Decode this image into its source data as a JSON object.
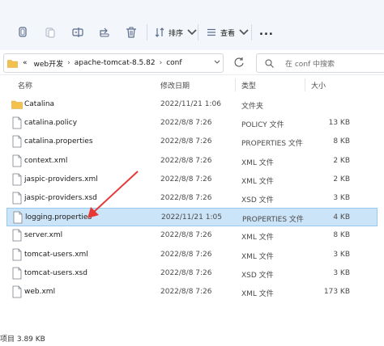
{
  "toolbar": {
    "sort_label": "排序",
    "view_label": "查看",
    "more_label": "..."
  },
  "address": {
    "overflow": "«",
    "crumbs": [
      "web开发",
      "apache-tomcat-8.5.82",
      "conf"
    ]
  },
  "search": {
    "placeholder": "在 conf 中搜索"
  },
  "columns": {
    "name": "名称",
    "modified": "修改日期",
    "type": "类型",
    "size": "大小"
  },
  "files": [
    {
      "name": "Catalina",
      "modified": "2022/11/21 1:06",
      "type": "文件夹",
      "size": "",
      "icon": "folder-icon"
    },
    {
      "name": "catalina.policy",
      "modified": "2022/8/8 7:26",
      "type": "POLICY 文件",
      "size": "13 KB",
      "icon": "file-icon"
    },
    {
      "name": "catalina.properties",
      "modified": "2022/8/8 7:26",
      "type": "PROPERTIES 文件",
      "size": "8 KB",
      "icon": "file-icon"
    },
    {
      "name": "context.xml",
      "modified": "2022/8/8 7:26",
      "type": "XML 文件",
      "size": "2 KB",
      "icon": "file-icon"
    },
    {
      "name": "jaspic-providers.xml",
      "modified": "2022/8/8 7:26",
      "type": "XML 文件",
      "size": "2 KB",
      "icon": "file-icon"
    },
    {
      "name": "jaspic-providers.xsd",
      "modified": "2022/8/8 7:26",
      "type": "XSD 文件",
      "size": "3 KB",
      "icon": "file-icon"
    },
    {
      "name": "logging.properties",
      "modified": "2022/11/21 1:05",
      "type": "PROPERTIES 文件",
      "size": "4 KB",
      "icon": "file-icon",
      "selected": true
    },
    {
      "name": "server.xml",
      "modified": "2022/8/8 7:26",
      "type": "XML 文件",
      "size": "8 KB",
      "icon": "file-icon"
    },
    {
      "name": "tomcat-users.xml",
      "modified": "2022/8/8 7:26",
      "type": "XML 文件",
      "size": "3 KB",
      "icon": "file-icon"
    },
    {
      "name": "tomcat-users.xsd",
      "modified": "2022/8/8 7:26",
      "type": "XSD 文件",
      "size": "3 KB",
      "icon": "file-icon"
    },
    {
      "name": "web.xml",
      "modified": "2022/8/8 7:26",
      "type": "XML 文件",
      "size": "173 KB",
      "icon": "file-icon"
    }
  ],
  "status": {
    "text": "项目  3.89 KB"
  },
  "colors": {
    "selection": "#cce4f7",
    "selection_border": "#99c9ef",
    "folder": "#f2c14e",
    "annotation_arrow": "#e53935"
  }
}
